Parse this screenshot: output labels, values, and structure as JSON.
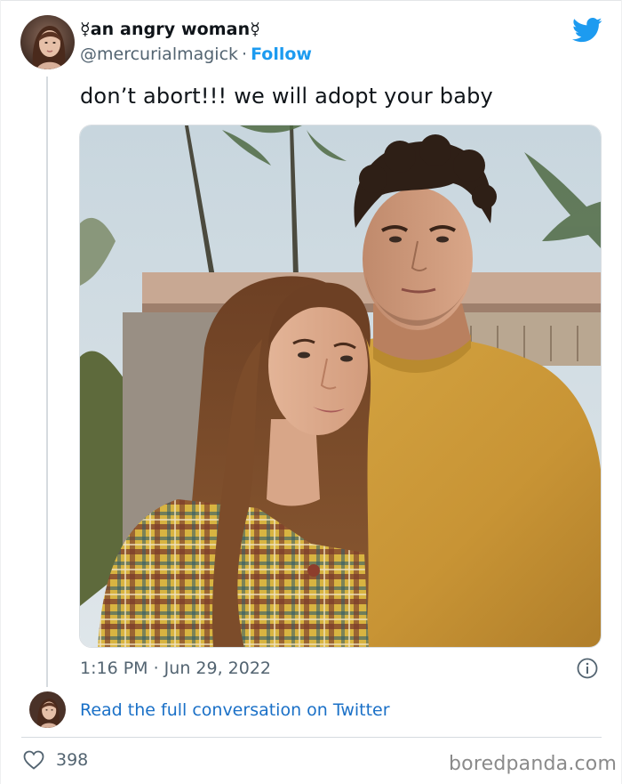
{
  "tweet": {
    "display_name": "☿an angry woman☿",
    "handle": "@mercurialmagick",
    "separator": "·",
    "follow_label": "Follow",
    "text": "don’t abort!!! we will adopt your baby",
    "timestamp": "1:16 PM · Jun 29, 2022",
    "read_more_label": "Read the full conversation on Twitter",
    "like_count": "398"
  },
  "watermark": "boredpanda.com",
  "icons": {
    "brand": "twitter-bird-icon",
    "info": "info-icon",
    "like": "heart-icon"
  },
  "colors": {
    "accent_blue": "#1d9bf0",
    "link_blue": "#1a70c7",
    "muted_text": "#536471"
  }
}
